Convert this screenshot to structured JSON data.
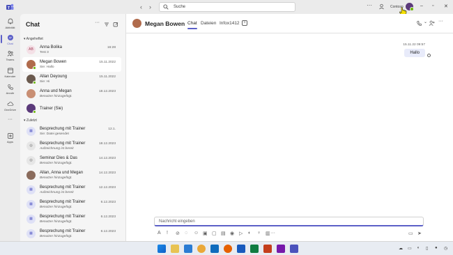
{
  "titlebar": {
    "search_placeholder": "Suche",
    "org_label": "Contoso",
    "more": "···"
  },
  "rail": [
    {
      "label": "Aktivität",
      "icon": "bell-icon"
    },
    {
      "label": "Chat",
      "icon": "chat-icon",
      "active": true
    },
    {
      "label": "Teams",
      "icon": "teams-icon"
    },
    {
      "label": "Kalender",
      "icon": "calendar-icon"
    },
    {
      "label": "Anrufe",
      "icon": "phone-icon"
    },
    {
      "label": "OneDrive",
      "icon": "cloud-icon"
    },
    {
      "label": "Apps",
      "icon": "apps-icon"
    }
  ],
  "chatlist": {
    "title": "Chat",
    "section_pinned": "Angeheftet",
    "section_recent": "Zuletzt",
    "pinned": [
      {
        "name": "Anna Bolika",
        "sub": "Test 3",
        "date": "16:28",
        "initials": "AB"
      },
      {
        "name": "Megan Bowen",
        "sub": "Sie: Hallo",
        "date": "15.11.2022",
        "selected": true
      },
      {
        "name": "Allan Deyoung",
        "sub": "Sie: Hi",
        "date": "15.11.2022"
      },
      {
        "name": "Anna und Megan",
        "sub": "Benutzer hinzugefügt.",
        "date": "18.12.2023",
        "italic": true
      },
      {
        "name": "Trainer (Sie)",
        "sub": "",
        "date": ""
      }
    ],
    "recent": [
      {
        "name": "Besprechung mit Trainer",
        "sub": "Sie: Datei gesendet",
        "date": "12.1."
      },
      {
        "name": "Besprechung mit Trainer",
        "sub": "Aufzeichnung ist bereit",
        "date": "18.12.2023",
        "italic": true
      },
      {
        "name": "Seminar Dies & Das",
        "sub": "Benutzer hinzugefügt.",
        "date": "14.12.2023",
        "italic": true
      },
      {
        "name": "Allan, Anna und Megan",
        "sub": "Benutzer hinzugefügt.",
        "date": "14.12.2023",
        "italic": true
      },
      {
        "name": "Besprechung mit Trainer",
        "sub": "Aufzeichnung ist bereit",
        "date": "12.12.2023",
        "italic": true
      },
      {
        "name": "Besprechung mit Trainer",
        "sub": "Benutzer hinzugefügt.",
        "date": "6.12.2023",
        "italic": true
      },
      {
        "name": "Besprechung mit Trainer",
        "sub": "Benutzer hinzugefügt.",
        "date": "6.12.2023",
        "italic": true
      },
      {
        "name": "Besprechung mit Trainer",
        "sub": "Benutzer hinzugefügt.",
        "date": "6.12.2023",
        "italic": true
      }
    ]
  },
  "main": {
    "contact_name": "Megan Bowen",
    "tabs": [
      "Chat",
      "Dateien",
      "Infox1412"
    ],
    "message_time": "15.11.22 09:57",
    "message_text": "Hallo",
    "compose_placeholder": "Nachricht eingeben"
  },
  "colors": {
    "accent": "#5b5fc7",
    "presence": "#6bb700",
    "bubble": "#e8ebfa"
  }
}
